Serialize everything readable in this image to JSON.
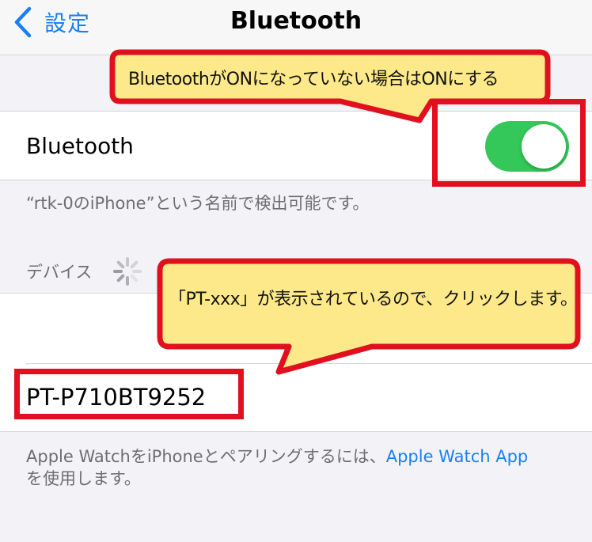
{
  "navbar": {
    "back_label": "設定",
    "title": "Bluetooth"
  },
  "bluetooth": {
    "label": "Bluetooth",
    "toggle_on": true,
    "discoverable_note": "“rtk-0のiPhone”という名前で検出可能です。"
  },
  "devices": {
    "header": "デバイス",
    "items": [
      {
        "name": "PT-P710BT9252"
      }
    ]
  },
  "footnote": {
    "text": "Apple WatchをiPhoneとペアリングするには、",
    "link": "Apple Watch App",
    "text2": "を使用します。"
  },
  "annotations": {
    "callout_toggle": "BluetoothがONになっていない場合はONにする",
    "callout_device": "「PT-xxx」が表示されているので、クリックします。"
  },
  "colors": {
    "accent": "#1a7ff6",
    "toggle_on": "#34c759",
    "annotation_red": "#e0101e",
    "callout_fill": "#fde98a"
  }
}
